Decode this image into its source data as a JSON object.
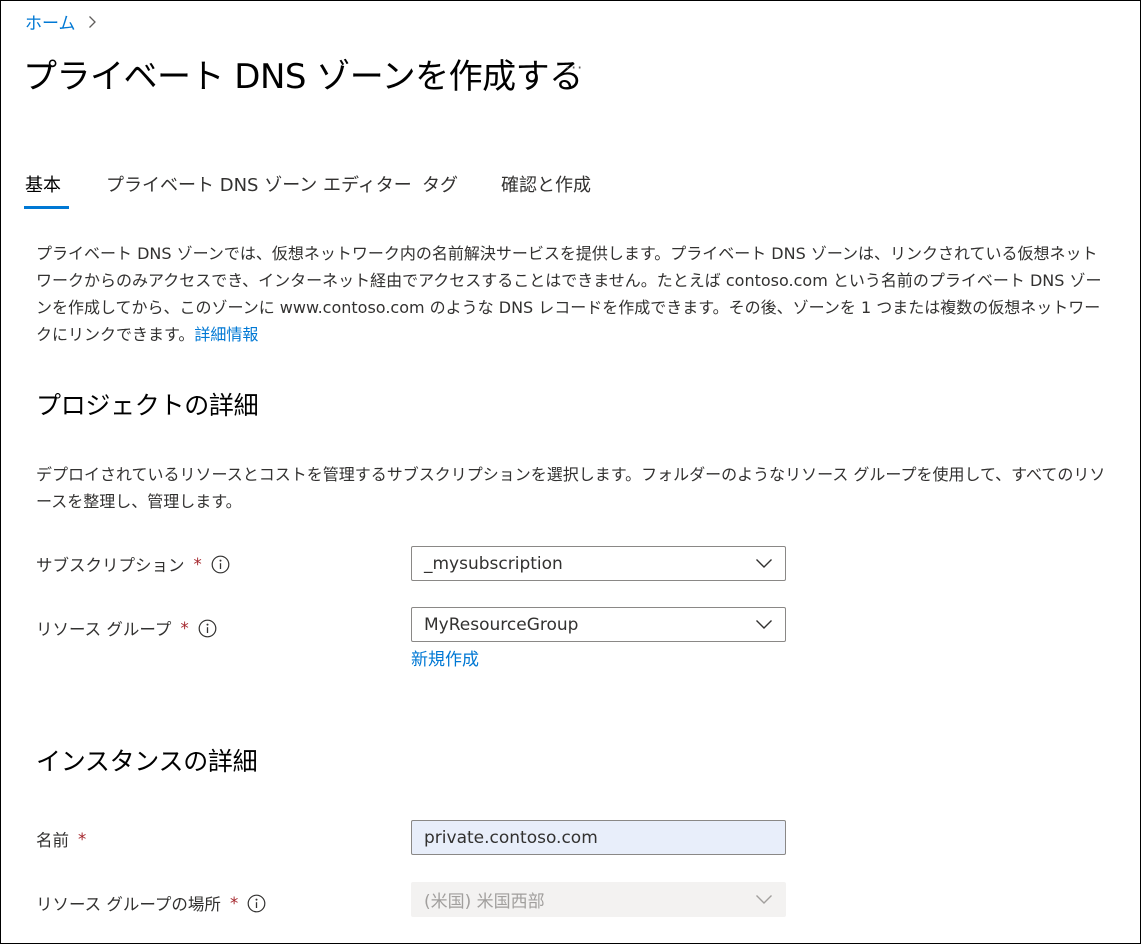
{
  "breadcrumb": {
    "home": "ホーム"
  },
  "page": {
    "title": "プライベート DNS ゾーンを作成する",
    "more": "···"
  },
  "tabs": [
    {
      "label": "基本",
      "active": true
    },
    {
      "label": "プライベート DNS ゾーン エディター"
    },
    {
      "label": "タグ"
    },
    {
      "label": "確認と作成"
    }
  ],
  "intro": {
    "text": "プライベート DNS ゾーンでは、仮想ネットワーク内の名前解決サービスを提供します。プライベート DNS ゾーンは、リンクされている仮想ネットワークからのみアクセスでき、インターネット経由でアクセスすることはできません。たとえば contoso.com という名前のプライベート DNS ゾーンを作成してから、このゾーンに www.contoso.com のような DNS レコードを作成できます。その後、ゾーンを 1 つまたは複数の仮想ネットワークにリンクできます。",
    "learn_more": "詳細情報"
  },
  "project": {
    "heading": "プロジェクトの詳細",
    "description": "デプロイされているリソースとコストを管理するサブスクリプションを選択します。フォルダーのようなリソース グループを使用して、すべてのリソースを整理し、管理します。",
    "subscription": {
      "label": "サブスクリプション",
      "required": "*",
      "value": "_mysubscription"
    },
    "resource_group": {
      "label": "リソース グループ",
      "required": "*",
      "value": "MyResourceGroup",
      "create_new": "新規作成"
    }
  },
  "instance": {
    "heading": "インスタンスの詳細",
    "name": {
      "label": "名前",
      "required": "*",
      "value": "private.contoso.com"
    },
    "location": {
      "label": "リソース グループの場所",
      "required": "*",
      "value": "(米国) 米国西部"
    }
  },
  "colors": {
    "accent": "#0078d4",
    "required": "#a4262c",
    "filled_bg": "#e8eefa",
    "disabled_bg": "#f3f2f1"
  },
  "icons": [
    "chevron-right-icon",
    "info-icon",
    "chevron-down-icon"
  ]
}
